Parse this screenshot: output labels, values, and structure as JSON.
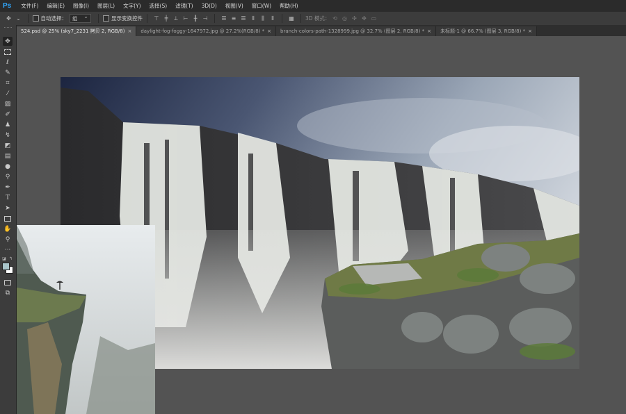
{
  "app": {
    "logo": "Ps"
  },
  "menubar": [
    "文件(F)",
    "编辑(E)",
    "图像(I)",
    "图层(L)",
    "文字(Y)",
    "选择(S)",
    "滤镜(T)",
    "3D(D)",
    "视图(V)",
    "窗口(W)",
    "帮助(H)"
  ],
  "options": {
    "auto_select_label": "自动选择：",
    "auto_select_value": "组",
    "show_transform_label": "显示变换控件",
    "mode_3d_label": "3D 模式："
  },
  "tabs": [
    {
      "label": "524.psd @ 25% (sky7_2231 拷贝 2, RGB/8)",
      "active": true
    },
    {
      "label": "daylight-fog-foggy-1647972.jpg @ 27.2%(RGB/8) *",
      "active": false
    },
    {
      "label": "branch-colors-path-1328999.jpg @ 32.7% (图层 2, RGB/8) *",
      "active": false
    },
    {
      "label": "未标题-1 @ 66.7% (图层 3, RGB/8) *",
      "active": false
    }
  ],
  "tab_close_glyph": "×",
  "tools": [
    "move-tool",
    "marquee-tool",
    "lasso-tool",
    "quick-select-tool",
    "crop-tool",
    "eyedropper-tool",
    "healing-brush-tool",
    "brush-tool",
    "clone-stamp-tool",
    "history-brush-tool",
    "eraser-tool",
    "gradient-tool",
    "blur-tool",
    "dodge-tool",
    "pen-tool",
    "type-tool",
    "path-select-tool",
    "rectangle-tool",
    "hand-tool",
    "zoom-tool",
    "more-tools"
  ],
  "colors": {
    "foreground": "#a8c4c9",
    "background": "#ffffff",
    "accent": "#31a8ff"
  }
}
